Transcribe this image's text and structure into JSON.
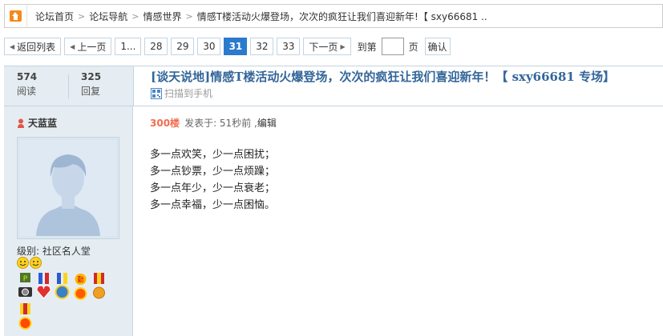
{
  "breadcrumb": {
    "home_icon": "home-icon",
    "items": [
      "论坛首页",
      "论坛导航",
      "情感世界",
      "情感T楼活动火爆登场，次次的疯狂让我们喜迎新年!【 sxy66681 .."
    ],
    "separator": ">"
  },
  "pager": {
    "back": "返回列表",
    "prev": "上一页",
    "ellipsis": "1...",
    "pages": [
      "28",
      "29",
      "30",
      "31",
      "32",
      "33"
    ],
    "current": "31",
    "next": "下一页",
    "goto_label": "到第",
    "goto_value": "",
    "goto_unit": "页",
    "confirm": "确认"
  },
  "stats": {
    "views_value": "574",
    "views_label": "阅读",
    "replies_value": "325",
    "replies_label": "回复"
  },
  "thread": {
    "title": "[谈天说地]情感T楼活动火爆登场，次次的疯狂让我们喜迎新年！【 sxy66681 专场】",
    "qr_label": "扫描到手机"
  },
  "author": {
    "name": "天蓝蓝",
    "level": "级别: 社区名人堂"
  },
  "post": {
    "floor": "300楼",
    "posted_at": "发表于: 51秒前 ,",
    "edit": "编辑",
    "lines": [
      "多一点欢笑，少一点困扰；",
      "多一点钞票，少一点烦躁；",
      "多一点年少，少一点衰老；",
      "多一点幸福，少一点困恼。"
    ]
  },
  "colors": {
    "accent": "#2b7acd",
    "title": "#336699",
    "floor": "#f26c4f",
    "author_bg": "#e5edf2",
    "border": "#c2d5e3"
  }
}
